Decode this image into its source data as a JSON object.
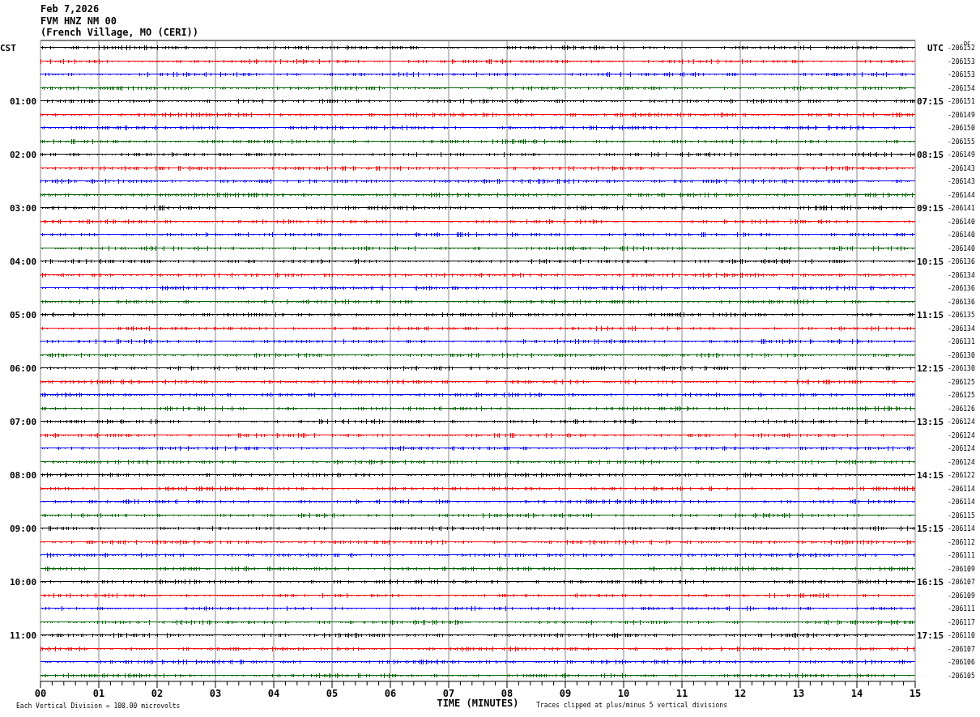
{
  "header": [
    "Feb 7,2026",
    "FVM HNZ NM 00",
    "(French Village, MO (CERI))"
  ],
  "left_labels": [
    "CST",
    "01:00",
    "02:00",
    "03:00",
    "04:00",
    "05:00",
    "06:00",
    "07:00",
    "08:00",
    "09:00",
    "10:00",
    "11:00"
  ],
  "right_labels": [
    "UTC",
    "07:15",
    "08:15",
    "09:15",
    "10:15",
    "11:15",
    "12:15",
    "13:15",
    "14:15",
    "15:15",
    "16:15",
    "17:15"
  ],
  "dc_heading": "DC",
  "rows": [
    {
      "color": "#000000",
      "dc": "-206152"
    },
    {
      "color": "#ff0000",
      "dc": "-206153"
    },
    {
      "color": "#0000ff",
      "dc": "-206153"
    },
    {
      "color": "#006400",
      "dc": "-206154"
    },
    {
      "color": "#000000",
      "dc": "-206151"
    },
    {
      "color": "#ff0000",
      "dc": "-206149"
    },
    {
      "color": "#0000ff",
      "dc": "-206150"
    },
    {
      "color": "#006400",
      "dc": "-206155"
    },
    {
      "color": "#000000",
      "dc": "-206149"
    },
    {
      "color": "#ff0000",
      "dc": "-206143"
    },
    {
      "color": "#0000ff",
      "dc": "-206143"
    },
    {
      "color": "#006400",
      "dc": "-206144"
    },
    {
      "color": "#000000",
      "dc": "-206141"
    },
    {
      "color": "#ff0000",
      "dc": "-206140"
    },
    {
      "color": "#0000ff",
      "dc": "-206140"
    },
    {
      "color": "#006400",
      "dc": "-206140"
    },
    {
      "color": "#000000",
      "dc": "-206136"
    },
    {
      "color": "#ff0000",
      "dc": "-206134"
    },
    {
      "color": "#0000ff",
      "dc": "-206136"
    },
    {
      "color": "#006400",
      "dc": "-206136"
    },
    {
      "color": "#000000",
      "dc": "-206135"
    },
    {
      "color": "#ff0000",
      "dc": "-206134"
    },
    {
      "color": "#0000ff",
      "dc": "-206131"
    },
    {
      "color": "#006400",
      "dc": "-206130"
    },
    {
      "color": "#000000",
      "dc": "-206130"
    },
    {
      "color": "#ff0000",
      "dc": "-206125"
    },
    {
      "color": "#0000ff",
      "dc": "-206125"
    },
    {
      "color": "#006400",
      "dc": "-206126"
    },
    {
      "color": "#000000",
      "dc": "-206124"
    },
    {
      "color": "#ff0000",
      "dc": "-206124"
    },
    {
      "color": "#0000ff",
      "dc": "-206124"
    },
    {
      "color": "#006400",
      "dc": "-206124"
    },
    {
      "color": "#000000",
      "dc": "-206122"
    },
    {
      "color": "#ff0000",
      "dc": "-206114"
    },
    {
      "color": "#0000ff",
      "dc": "-206114"
    },
    {
      "color": "#006400",
      "dc": "-206115"
    },
    {
      "color": "#000000",
      "dc": "-206114"
    },
    {
      "color": "#ff0000",
      "dc": "-206112"
    },
    {
      "color": "#0000ff",
      "dc": "-206111"
    },
    {
      "color": "#006400",
      "dc": "-206109"
    },
    {
      "color": "#000000",
      "dc": "-206107"
    },
    {
      "color": "#ff0000",
      "dc": "-206109"
    },
    {
      "color": "#0000ff",
      "dc": "-206111"
    },
    {
      "color": "#006400",
      "dc": "-206117"
    },
    {
      "color": "#000000",
      "dc": "-206110"
    },
    {
      "color": "#ff0000",
      "dc": "-206107"
    },
    {
      "color": "#0000ff",
      "dc": "-206106"
    },
    {
      "color": "#006400",
      "dc": "-206105"
    }
  ],
  "x_ticks": [
    "00",
    "01",
    "02",
    "03",
    "04",
    "05",
    "06",
    "07",
    "08",
    "09",
    "10",
    "11",
    "12",
    "13",
    "14",
    "15"
  ],
  "x_label": "TIME (MINUTES)",
  "scale_note": "Each Vertical Division =  100.00 microvolts",
  "clip_note": "Traces clipped at plus/minus 5 vertical divisions"
}
